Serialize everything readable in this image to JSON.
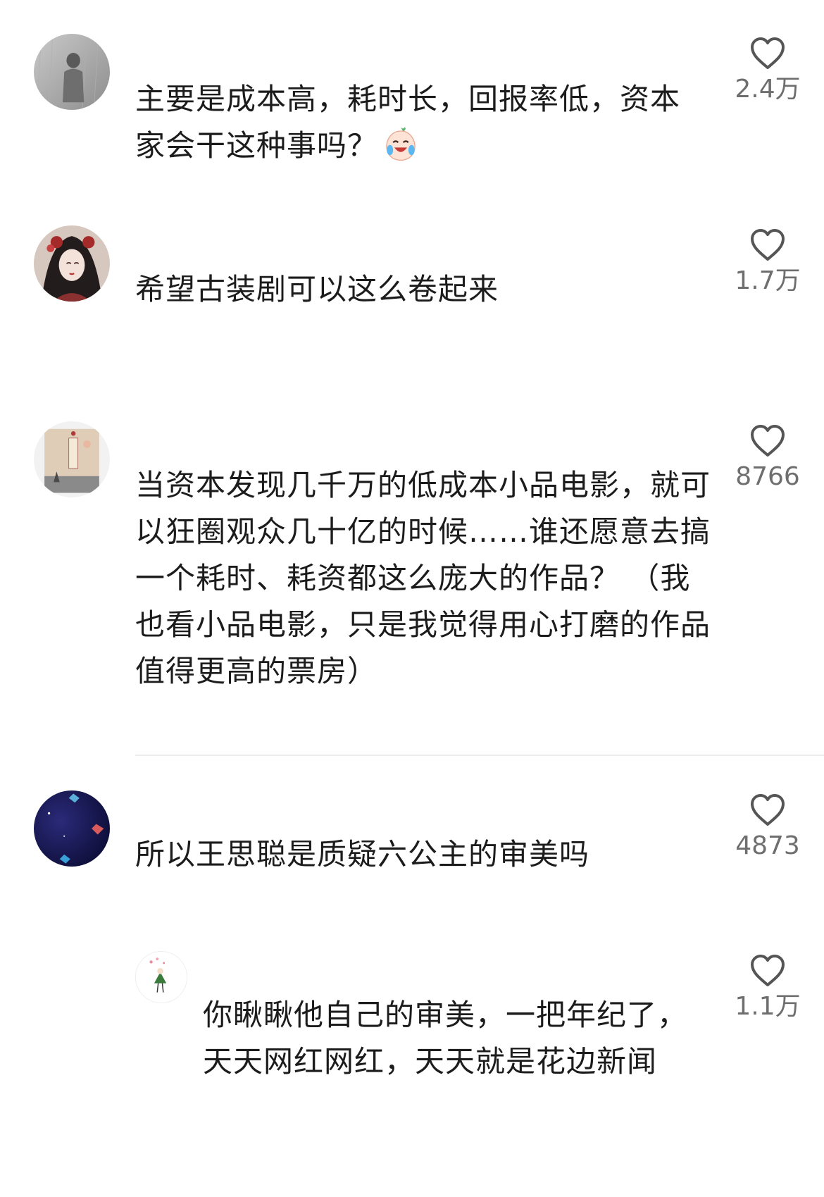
{
  "comments": [
    {
      "text": "主要是成本高，耗时长，回报率低，资本家会干这种事吗？",
      "likes": "2.4万",
      "emoji": "laughing-crying-peach-emoji"
    },
    {
      "text": "希望古装剧可以这么卷起来",
      "likes": "1.7万"
    },
    {
      "text": "当资本发现几千万的低成本小品电影，就可以狂圈观众几十亿的时候……谁还愿意去搞一个耗时、耗资都这么庞大的作品？ （我也看小品电影，只是我觉得用心打磨的作品值得更高的票房）",
      "likes": "8766"
    },
    {
      "text": "所以王思聪是质疑六公主的审美吗",
      "likes": "4873"
    },
    {
      "text": "你瞅瞅他自己的审美，一把年纪了，天天网红网红，天天就是花边新闻",
      "likes": "1.1万"
    }
  ],
  "icons": {
    "like": "heart-outline-icon"
  },
  "colors": {
    "text": "#1c1c1c",
    "count": "#6e6e6e",
    "heart": "#555555"
  }
}
